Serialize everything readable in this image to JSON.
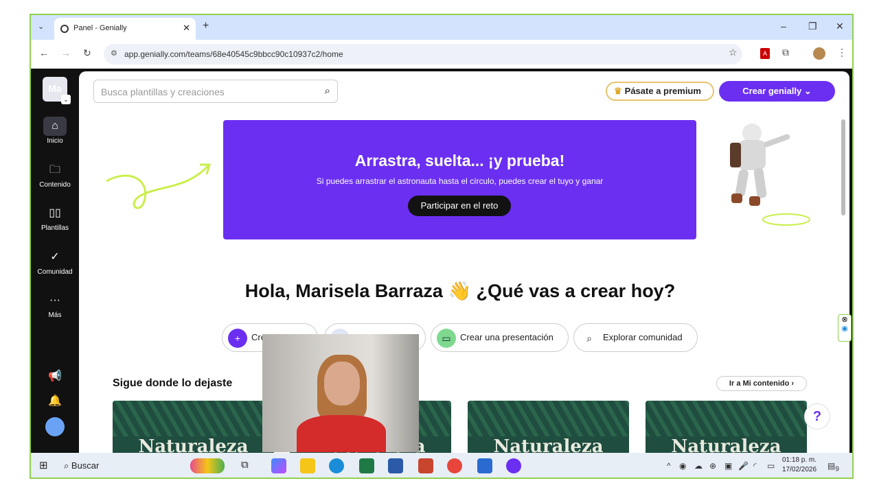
{
  "browser": {
    "tab_title": "Panel - Genially",
    "url": "app.genially.com/teams/68e40545c9bbcc90c10937c2/home",
    "new_tab": "+",
    "close_tab": "✕"
  },
  "sidebar": {
    "workspace_initials": "Ma",
    "items": [
      {
        "label": "Inicio",
        "icon": "home-icon"
      },
      {
        "label": "Contenido",
        "icon": "folder-icon"
      },
      {
        "label": "Plantillas",
        "icon": "templates-icon"
      },
      {
        "label": "Comunidad",
        "icon": "community-icon"
      },
      {
        "label": "Más",
        "icon": "more-icon"
      }
    ]
  },
  "header": {
    "search_placeholder": "Busca plantillas y creaciones",
    "premium_label": "Pásate a premium",
    "create_label": "Crear genially"
  },
  "banner": {
    "title": "Arrastra, suelta... ¡y prueba!",
    "subtitle": "Si puedes arrastrar el astronauta hasta el círculo, puedes crear el tuyo y ganar",
    "button": "Participar en el reto"
  },
  "greeting": "Hola, Marisela Barraza 👋 ¿Qué vas a crear hoy?",
  "actions": [
    {
      "label": "Cre",
      "icon": "plus-icon"
    },
    {
      "label": "",
      "icon": "generic-icon"
    },
    {
      "label": "Crear una presentación",
      "icon": "presentation-icon"
    },
    {
      "label": "Explorar comunidad",
      "icon": "search-icon"
    }
  ],
  "continue": {
    "title": "Sigue donde lo dejaste",
    "goto_label": "Ir a Mi contenido"
  },
  "cards": [
    {
      "title": "Naturaleza"
    },
    {
      "title": "Naturaleza"
    },
    {
      "title": "Naturaleza"
    },
    {
      "title": "Naturaleza"
    }
  ],
  "help_label": "?",
  "taskbar": {
    "search_label": "Buscar",
    "time": "01:18 p. m.",
    "date": "17/02/2026",
    "notification_count": "9"
  },
  "colors": {
    "accent": "#6b2ff2",
    "frame": "#8fd14f"
  }
}
